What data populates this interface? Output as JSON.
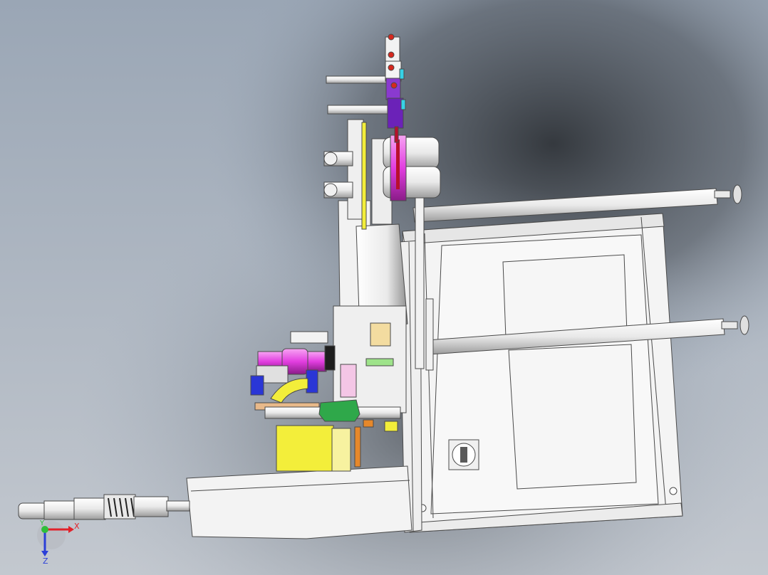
{
  "viewport": {
    "background_top": "#9aa6b5",
    "background_bottom": "#c7cbd2",
    "shadow_color": "#2f3338"
  },
  "triad": {
    "x_label": "X",
    "y_label": "Y",
    "z_label": "Z",
    "x_color": "#e1222a",
    "y_color": "#2fbf3a",
    "z_color": "#2b3fd8"
  },
  "colors": {
    "frame_white": "#f4f4f4",
    "frame_line": "#5a5a5a",
    "magenta": "#e23ee0",
    "purple": "#6b22b8",
    "yellow": "#f3ee3a",
    "blue": "#2a36d6",
    "green": "#2fa84a",
    "orange": "#e6882b",
    "tan": "#e8b98a",
    "red": "#d6281e",
    "cyan": "#37d2e6"
  }
}
